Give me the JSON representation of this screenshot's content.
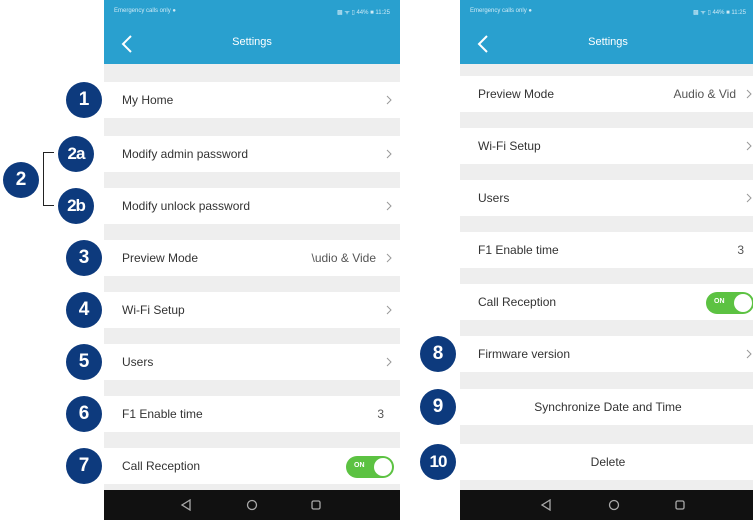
{
  "colors": {
    "header": "#29a0cf",
    "badge": "#0d3a7d",
    "toggle_on": "#5cc242",
    "nav": "#111111"
  },
  "left_screen": {
    "status_left": "Emergency calls only ●",
    "status_right": "▩ ᯤ ▯ 44% ■ 11:25",
    "title": "Settings",
    "rows": [
      {
        "label": "My Home",
        "value": ""
      },
      {
        "label": "Modify admin password",
        "value": ""
      },
      {
        "label": "Modify unlock password",
        "value": ""
      },
      {
        "label": "Preview Mode",
        "value": "\\udio & Vide"
      },
      {
        "label": "Wi-Fi Setup",
        "value": ""
      },
      {
        "label": "Users",
        "value": ""
      },
      {
        "label": "F1 Enable time",
        "value": "3"
      },
      {
        "label": "Call Reception",
        "value": "ON"
      }
    ]
  },
  "right_screen": {
    "status_left": "Emergency calls only ●",
    "status_right": "▩ ᯤ ▯ 44% ■ 11:25",
    "title": "Settings",
    "rows": [
      {
        "label": "Preview Mode",
        "value": "Audio & Vid"
      },
      {
        "label": "Wi-Fi Setup",
        "value": ""
      },
      {
        "label": "Users",
        "value": ""
      },
      {
        "label": "F1 Enable time",
        "value": "3"
      },
      {
        "label": "Call Reception",
        "value": "ON"
      },
      {
        "label": "Firmware version",
        "value": ""
      },
      {
        "label": "Synchronize Date and Time",
        "value": ""
      },
      {
        "label": "Delete",
        "value": ""
      }
    ]
  },
  "badges": [
    "1",
    "2",
    "2a",
    "2b",
    "3",
    "4",
    "5",
    "6",
    "7",
    "8",
    "9",
    "10"
  ],
  "nav_icons": [
    "back-triangle-icon",
    "home-circle-icon",
    "recents-square-icon"
  ]
}
